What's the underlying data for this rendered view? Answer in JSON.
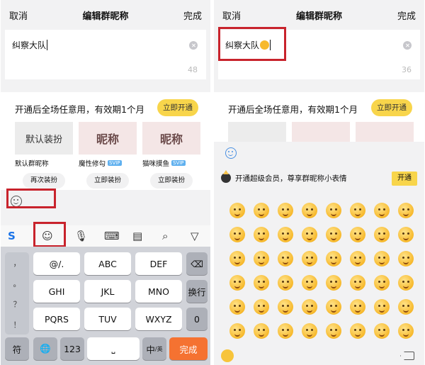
{
  "left": {
    "nav": {
      "cancel": "取消",
      "title": "编辑群昵称",
      "done": "完成"
    },
    "input": {
      "value": "纠察大队",
      "counter": "48"
    },
    "promo": {
      "text": "开通后全场任意用，有效期1个月",
      "button": "立即开通"
    },
    "skins": [
      {
        "thumb": "默认装扮",
        "name": "默认群昵称",
        "vip": "",
        "button": "再次装扮"
      },
      {
        "thumb": "昵称",
        "name": "魔性修勾",
        "vip": "SVIP",
        "button": "立即装扮"
      },
      {
        "thumb": "昵称",
        "name": "猫咪摸鱼",
        "vip": "SVIP",
        "button": "立即装扮"
      }
    ],
    "keyboard": {
      "sym": [
        "，",
        "。",
        "？",
        "！"
      ],
      "row1": [
        "@/.",
        "ABC",
        "DEF"
      ],
      "row2": [
        "GHI",
        "JKL",
        "MNO",
        "换行"
      ],
      "row3": [
        "PQRS",
        "TUV",
        "WXYZ",
        "0"
      ],
      "row4": [
        "符",
        "123",
        "中",
        "完成"
      ],
      "lang_sub": "/英"
    }
  },
  "right": {
    "nav": {
      "cancel": "取消",
      "title": "编辑群昵称",
      "done": "完成"
    },
    "input": {
      "value": "纠察大队",
      "counter": "36"
    },
    "promo": {
      "text": "开通后全场任意用，有效期1个月",
      "button": "立即开通"
    },
    "vip_row": {
      "text": "开通超级会员，尊享群昵称小表情",
      "button": "开通"
    }
  }
}
